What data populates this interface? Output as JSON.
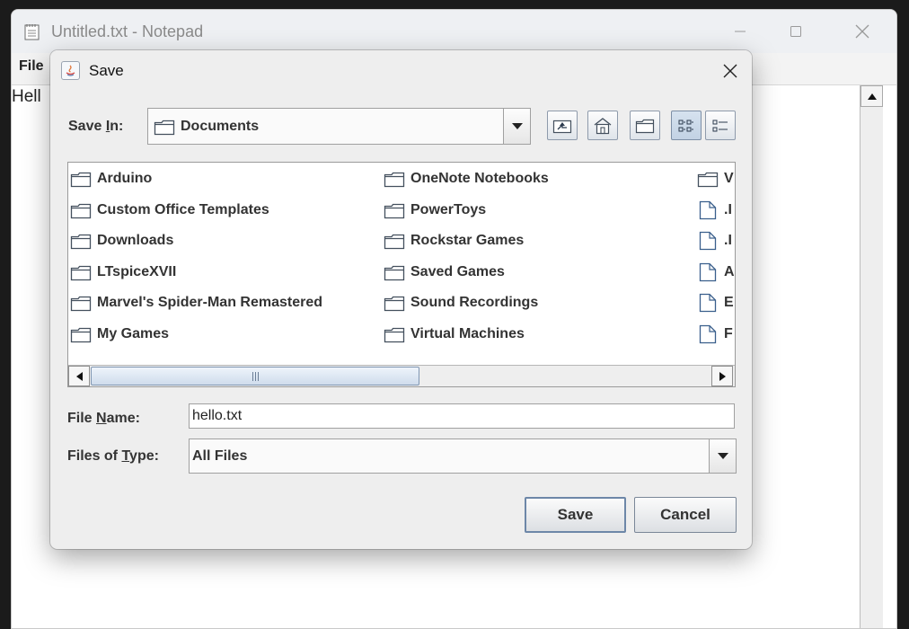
{
  "notepad": {
    "title": "Untitled.txt - Notepad",
    "menu_file": "File",
    "text_content": "Hell"
  },
  "dialog": {
    "title": "Save",
    "save_in_label_pre": "Save ",
    "save_in_label_mnemonic": "I",
    "save_in_label_post": "n:",
    "save_in_value": "Documents",
    "file_name_label_pre": "File ",
    "file_name_label_mnemonic": "N",
    "file_name_label_post": "ame:",
    "file_name_value": "hello.txt",
    "files_of_type_label_pre": "Files of ",
    "files_of_type_label_mnemonic": "T",
    "files_of_type_label_post": "ype:",
    "files_of_type_value": "All Files",
    "save_button": "Save",
    "cancel_button": "Cancel",
    "view_mode": "list",
    "files": {
      "col1": [
        "Arduino",
        "Custom Office Templates",
        "Downloads",
        "LTspiceXVII",
        "Marvel's Spider-Man Remastered",
        "My Games"
      ],
      "col2": [
        "OneNote Notebooks",
        "PowerToys",
        "Rockstar Games",
        "Saved Games",
        "Sound Recordings",
        "Virtual Machines"
      ],
      "col3": [
        {
          "text": "V",
          "kind": "folder"
        },
        {
          "text": ".I",
          "kind": "file"
        },
        {
          "text": ".I",
          "kind": "file"
        },
        {
          "text": "A",
          "kind": "file"
        },
        {
          "text": "E",
          "kind": "file"
        },
        {
          "text": "F",
          "kind": "file"
        }
      ]
    }
  },
  "colors": {
    "dialog_bg": "#eeeeee",
    "folder_stroke": "#44505e",
    "scroll_thumb": "#cfdcec"
  }
}
